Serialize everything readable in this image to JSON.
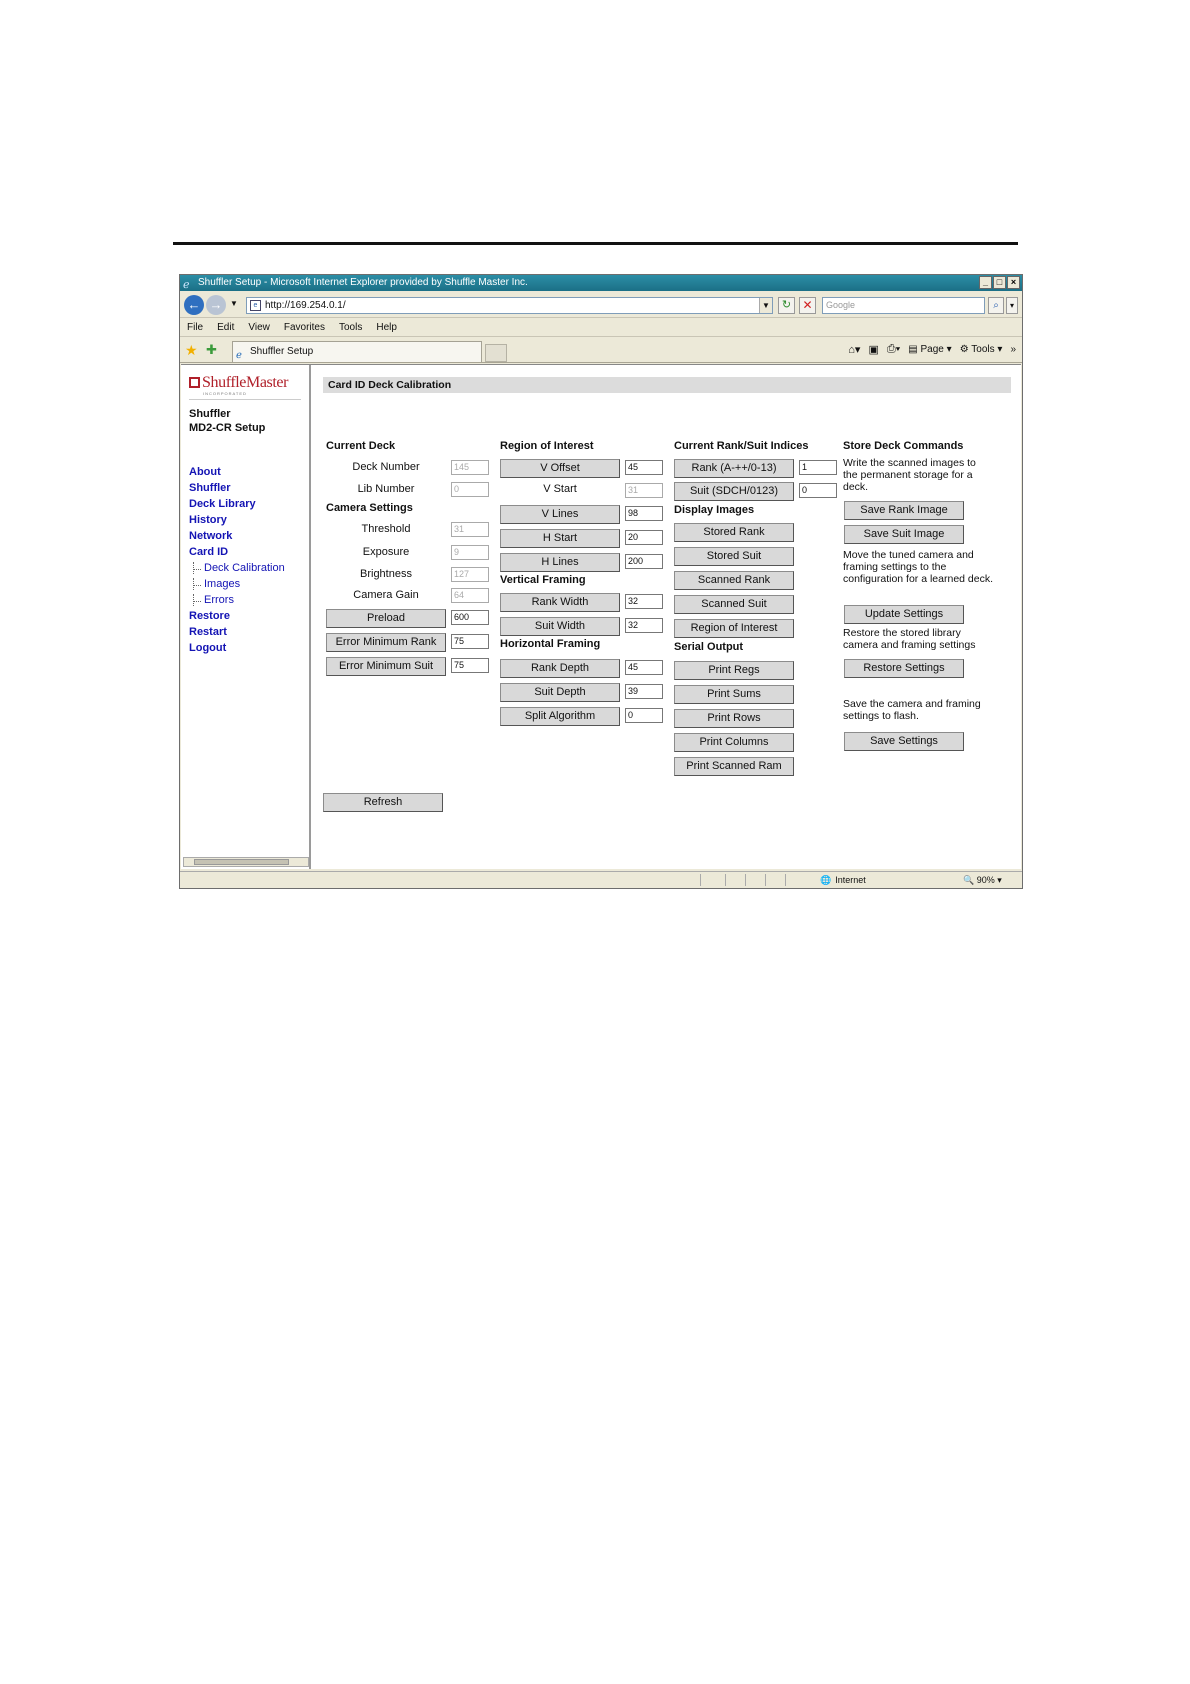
{
  "window": {
    "title": "Shuffler Setup - Microsoft Internet Explorer provided by Shuffle Master Inc.",
    "address": "http://169.254.0.1/",
    "search_placeholder": "Google",
    "menu": [
      "File",
      "Edit",
      "View",
      "Favorites",
      "Tools",
      "Help"
    ],
    "tab_label": "Shuffler Setup",
    "cmd_page": "Page",
    "cmd_tools": "Tools",
    "status_zone": "Internet",
    "status_zoom": "90%"
  },
  "sidebar": {
    "logo": "ShuffleMaster",
    "logo_sub": "INCORPORATED",
    "title_line1": "Shuffler",
    "title_line2": "MD2-CR Setup",
    "links": [
      "About",
      "Shuffler",
      "Deck Library",
      "History",
      "Network",
      "Card ID"
    ],
    "sublinks": [
      "Deck Calibration",
      "Images",
      "Errors"
    ],
    "links2": [
      "Restore",
      "Restart",
      "Logout"
    ]
  },
  "page": {
    "header": "Card ID Deck Calibration",
    "current_deck": {
      "heading": "Current Deck",
      "deck_number_label": "Deck Number",
      "deck_number": "145",
      "lib_number_label": "Lib Number",
      "lib_number": "0"
    },
    "camera": {
      "heading": "Camera Settings",
      "threshold_label": "Threshold",
      "threshold": "31",
      "exposure_label": "Exposure",
      "exposure": "9",
      "brightness_label": "Brightness",
      "brightness": "127",
      "gain_label": "Camera Gain",
      "gain": "64",
      "preload_label": "Preload",
      "preload": "600",
      "err_min_rank_label": "Error Minimum Rank",
      "err_min_rank": "75",
      "err_min_suit_label": "Error Minimum Suit",
      "err_min_suit": "75"
    },
    "roi": {
      "heading": "Region of Interest",
      "v_offset_label": "V Offset",
      "v_offset": "45",
      "v_start_label": "V Start",
      "v_start": "31",
      "v_lines_label": "V Lines",
      "v_lines": "98",
      "h_start_label": "H Start",
      "h_start": "20",
      "h_lines_label": "H Lines",
      "h_lines": "200"
    },
    "vertical": {
      "heading": "Vertical Framing",
      "rank_width_label": "Rank Width",
      "rank_width": "32",
      "suit_width_label": "Suit Width",
      "suit_width": "32"
    },
    "horizontal": {
      "heading": "Horizontal Framing",
      "rank_depth_label": "Rank Depth",
      "rank_depth": "45",
      "suit_depth_label": "Suit Depth",
      "suit_depth": "39",
      "split_label": "Split Algorithm",
      "split": "0"
    },
    "indices": {
      "heading": "Current Rank/Suit Indices",
      "rank_label": "Rank (A-++/0-13)",
      "rank": "1",
      "suit_label": "Suit (SDCH/0123)",
      "suit": "0"
    },
    "display": {
      "heading": "Display Images",
      "buttons": [
        "Stored Rank",
        "Stored Suit",
        "Scanned Rank",
        "Scanned Suit",
        "Region of Interest"
      ]
    },
    "serial": {
      "heading": "Serial Output",
      "buttons": [
        "Print Regs",
        "Print Sums",
        "Print Rows",
        "Print Columns",
        "Print Scanned Ram"
      ]
    },
    "store": {
      "heading": "Store Deck Commands",
      "desc1": "Write the scanned images to the permanent storage for a deck.",
      "save_rank": "Save Rank Image",
      "save_suit": "Save Suit Image",
      "desc2": "Move the tuned camera and framing settings to the configuration for a learned deck.",
      "update": "Update Settings",
      "desc3": "Restore the stored library camera and framing settings",
      "restore": "Restore Settings",
      "desc4": "Save the camera and framing settings to flash.",
      "save": "Save Settings"
    },
    "refresh": "Refresh"
  }
}
